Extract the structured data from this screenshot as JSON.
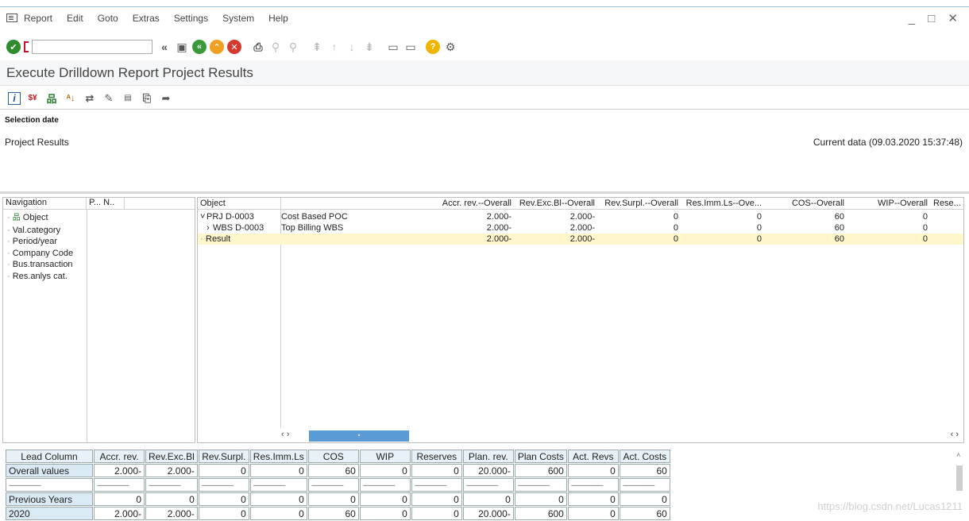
{
  "menu": [
    "Report",
    "Edit",
    "Goto",
    "Extras",
    "Settings",
    "System",
    "Help"
  ],
  "window_controls": "_ □ ✕",
  "command_field": {
    "value": ""
  },
  "page_title": "Execute Drilldown Report Project Results",
  "header": {
    "selection_date_label": "Selection date",
    "report_name": "Project Results",
    "current_data": "Current data (09.03.2020 15:37:48)"
  },
  "navigation": {
    "col1": "Navigation",
    "col2": "P... N..",
    "items": [
      "Object",
      "Val.category",
      "Period/year",
      "Company Code",
      "Bus.transaction",
      "Res.anlys cat."
    ]
  },
  "grid": {
    "columns": [
      "Object",
      "Accr. rev.--Overall",
      "Rev.Exc.Bl--Overall",
      "Rev.Surpl.--Overall",
      "Res.Imm.Ls--Ove...",
      "COS--Overall",
      "WIP--Overall",
      "Rese..."
    ],
    "rows": [
      {
        "object": "PRJ D-0003",
        "text": "Cost Based POC",
        "values": [
          "2.000-",
          "2.000-",
          "0",
          "0",
          "60",
          "0"
        ]
      },
      {
        "object": "WBS D-0003",
        "text": "Top Billing WBS",
        "values": [
          "2.000-",
          "2.000-",
          "0",
          "0",
          "60",
          "0"
        ]
      },
      {
        "object": "Result",
        "text": "",
        "values": [
          "2.000-",
          "2.000-",
          "0",
          "0",
          "60",
          "0"
        ]
      }
    ]
  },
  "footer_table": {
    "headers": [
      "Lead Column",
      "Accr. rev.",
      "Rev.Exc.Bl",
      "Rev.Surpl.",
      "Res.Imm.Ls",
      "COS",
      "WIP",
      "Reserves",
      "Plan. rev.",
      "Plan Costs",
      "Act. Revs",
      "Act. Costs"
    ],
    "rows": [
      {
        "label": "Overall values",
        "values": [
          "2.000-",
          "2.000-",
          "0",
          "0",
          "60",
          "0",
          "0",
          "20.000-",
          "600",
          "0",
          "60"
        ]
      },
      {
        "label": "--------------------",
        "values": [
          "",
          "",
          "",
          "",
          "",
          "",
          "",
          "",
          "",
          "",
          ""
        ]
      },
      {
        "label": "Previous Years",
        "values": [
          "0",
          "0",
          "0",
          "0",
          "0",
          "0",
          "0",
          "0",
          "0",
          "0",
          "0"
        ]
      },
      {
        "label": "2020",
        "values": [
          "2.000-",
          "2.000-",
          "0",
          "0",
          "60",
          "0",
          "0",
          "20.000-",
          "600",
          "0",
          "60"
        ]
      }
    ]
  },
  "watermark": "https://blog.csdn.net/Lucas1211",
  "icons": {
    "toolbar1": [
      "check-icon",
      "back-double-icon",
      "save-icon",
      "back-icon",
      "exit-icon",
      "cancel-icon",
      "print-icon",
      "find-icon",
      "find-next-icon",
      "first-page-icon",
      "prev-page-icon",
      "next-page-icon",
      "last-page-icon",
      "new-session-icon",
      "shortcut-icon",
      "help-icon",
      "settings-icon"
    ],
    "toolbar2": [
      "info-icon",
      "currency-icon",
      "hierarchy-icon",
      "sort-icon",
      "swap-icon",
      "edit-icon",
      "zoom-icon",
      "export-icon",
      "send-icon"
    ]
  },
  "colors": {
    "check": "#2e8b2e",
    "nav_green": "#3a9a3a",
    "exit_orange": "#f0a020",
    "cancel_red": "#d33a2c",
    "help_yellow": "#f0b400",
    "result_highlight": "#fff6cc",
    "scroll_thumb": "#5b9bd5"
  }
}
